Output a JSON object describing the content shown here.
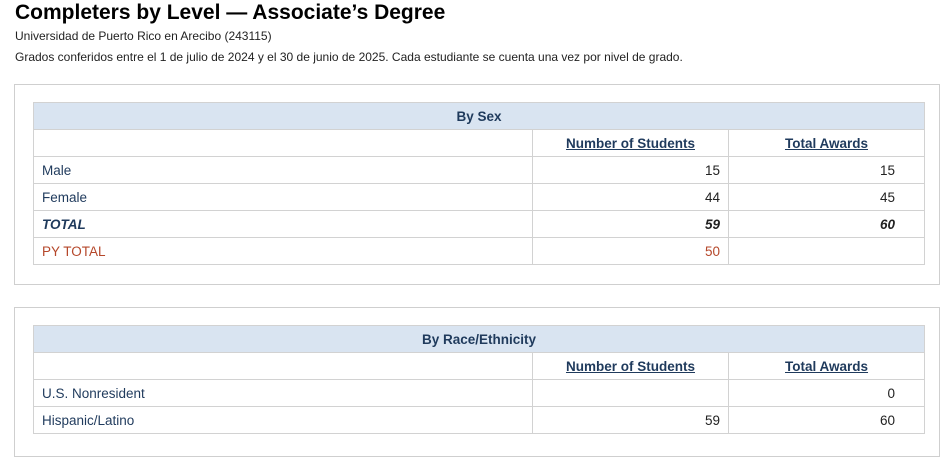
{
  "header": {
    "title": "Completers by Level — Associate’s Degree",
    "institution": "Universidad de Puerto Rico en Arecibo (243115)",
    "note": "Grados conferidos entre el 1 de julio de 2024 y el 30 de junio de 2025. Cada estudiante se cuenta una vez por nivel de grado."
  },
  "tables": {
    "sex": {
      "heading": "By Sex",
      "col_students": "Number of Students",
      "col_awards": "Total Awards",
      "rows": [
        {
          "label": "Male",
          "students": "15",
          "awards": "15"
        },
        {
          "label": "Female",
          "students": "44",
          "awards": "45"
        }
      ],
      "total": {
        "label": "TOTAL",
        "students": "59",
        "awards": "60"
      },
      "py_total": {
        "label": "PY TOTAL",
        "students": "50",
        "awards": ""
      }
    },
    "race": {
      "heading": "By Race/Ethnicity",
      "col_students": "Number of Students",
      "col_awards": "Total Awards",
      "rows": [
        {
          "label": "U.S. Nonresident",
          "students": "",
          "awards": "0"
        },
        {
          "label": "Hispanic/Latino",
          "students": "59",
          "awards": "60"
        }
      ]
    }
  },
  "colors": {
    "header_bg": "#d9e4f1",
    "link_text": "#1f3a5c",
    "py_total": "#b5472a"
  }
}
